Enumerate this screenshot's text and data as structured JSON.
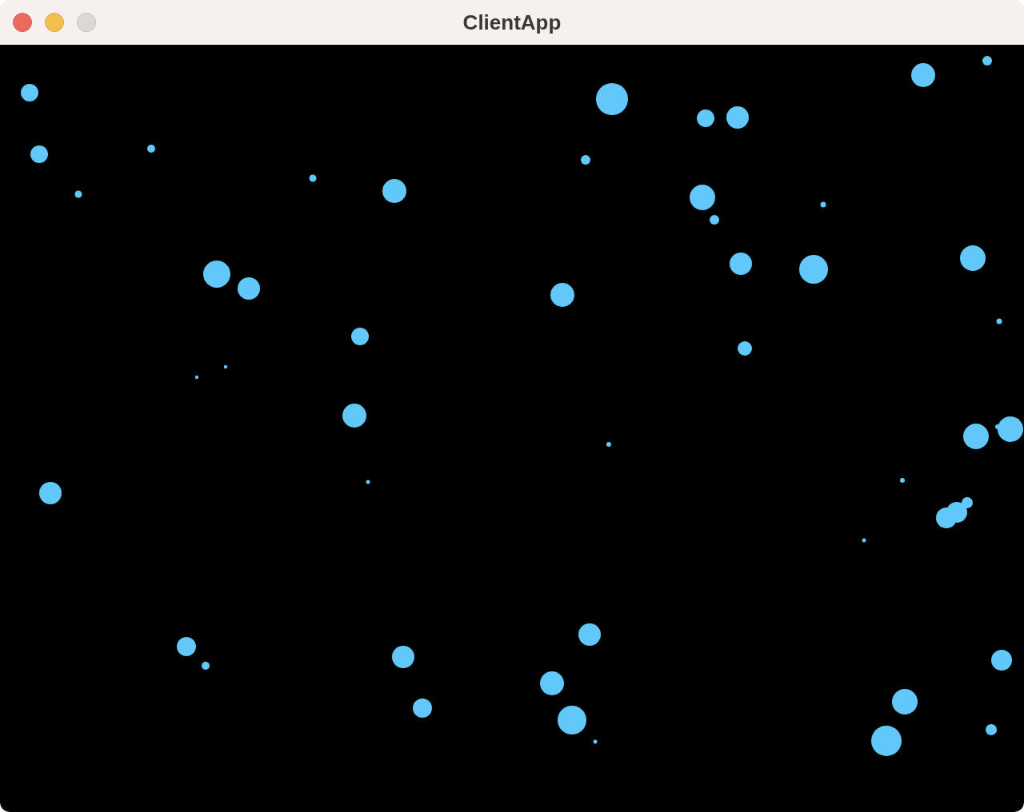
{
  "window": {
    "title": "ClientApp",
    "buttons": [
      {
        "kind": "close",
        "disabled": false
      },
      {
        "kind": "minimize",
        "disabled": false
      },
      {
        "kind": "zoom",
        "disabled": true
      }
    ]
  }
}
